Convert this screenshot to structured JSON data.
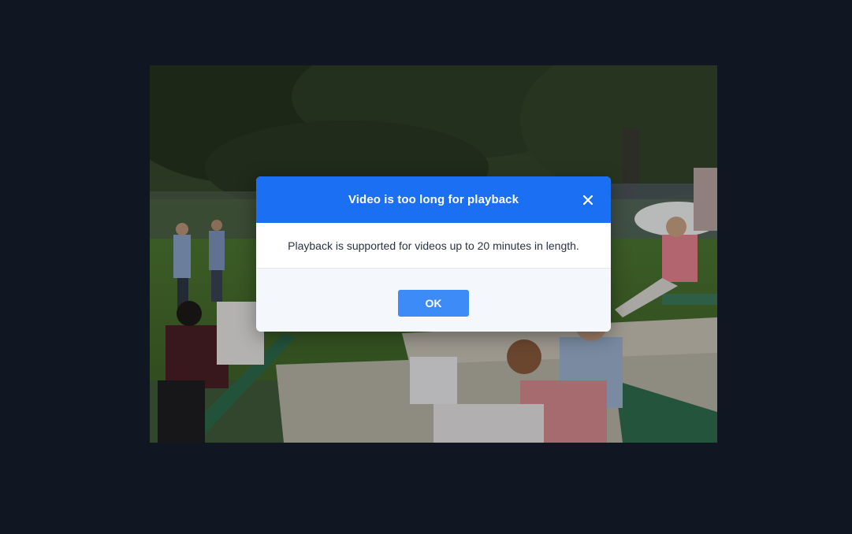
{
  "video": {
    "scene": "video-preview-park-crowd"
  },
  "dialog": {
    "title": "Video is too long for playback",
    "close_icon": "close-icon",
    "message": "Playback is supported for videos up to 20 minutes in length.",
    "ok_label": "OK"
  },
  "colors": {
    "page_background": "#101722",
    "header_blue": "#1a6ff2",
    "button_blue": "#3d8bf7",
    "footer_background": "#f4f7fb"
  }
}
